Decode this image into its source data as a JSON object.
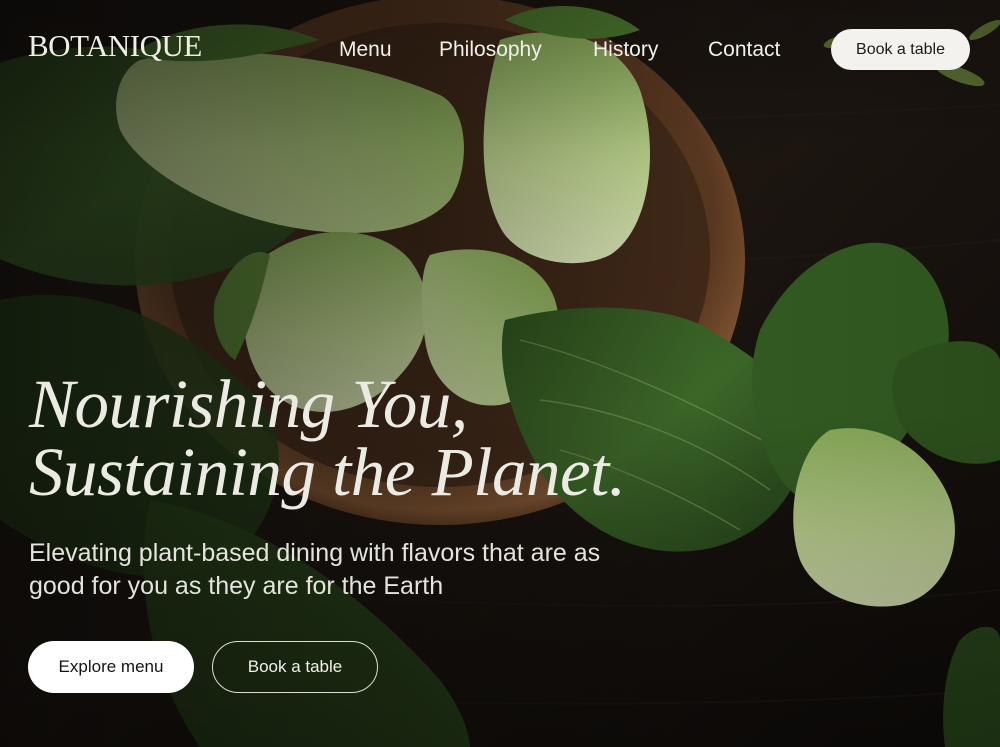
{
  "brand": {
    "logo_text": "BOTANIQUE"
  },
  "nav": {
    "items": [
      "Menu",
      "Philosophy",
      "History",
      "Contact"
    ],
    "book_label": "Book a table"
  },
  "hero": {
    "headline_line1": "Nourishing You,",
    "headline_line2": "Sustaining the Planet.",
    "subtitle": "Elevating plant-based dining with flavors that are as good for you as they are for the Earth",
    "primary_cta": "Explore menu",
    "secondary_cta": "Book a table",
    "background": "dark wooden table with wooden bowl and fresh bok choy"
  },
  "colors": {
    "text_light": "#efeee3",
    "button_bg": "#f4f2ee",
    "background": "#0f0d0b",
    "leaf_green": "#3f6b2a",
    "stem_green": "#b7cf84"
  }
}
